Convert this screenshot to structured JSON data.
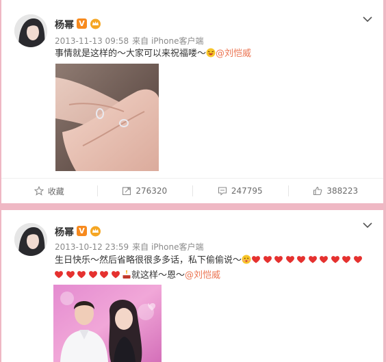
{
  "posts": [
    {
      "user_name": "杨幂",
      "verified_badge": "V",
      "timestamp": "2013-11-13 09:58",
      "source": "来自 iPhone客户端",
      "text": "事情就是这样的～大家可以来祝福喽～",
      "emojis": [
        "laughing-emoji"
      ],
      "mention": "@刘恺威",
      "image_icon": "photo-hands-rings",
      "actions": {
        "favorite_label": "收藏",
        "repost_count": "276320",
        "comment_count": "247795",
        "like_count": "388223"
      }
    },
    {
      "user_name": "杨幂",
      "verified_badge": "V",
      "timestamp": "2013-10-12 23:59",
      "source": "来自 iPhone客户端",
      "text_line1": "生日快乐～然后省略很很多多话，私下偷偷说～",
      "line1_hearts": 10,
      "line2_hearts": 6,
      "text_line2_after": "就这样～恩～",
      "emojis": [
        "kiss-emoji",
        "cake-emoji"
      ],
      "mention": "@刘恺威",
      "image_icon": "photo-couple"
    }
  ],
  "colors": {
    "background": "#efb8c4",
    "mention": "#eb7350",
    "meta": "#8a8a8a",
    "badge": "#f78a1e",
    "heart": "#e5312f"
  }
}
